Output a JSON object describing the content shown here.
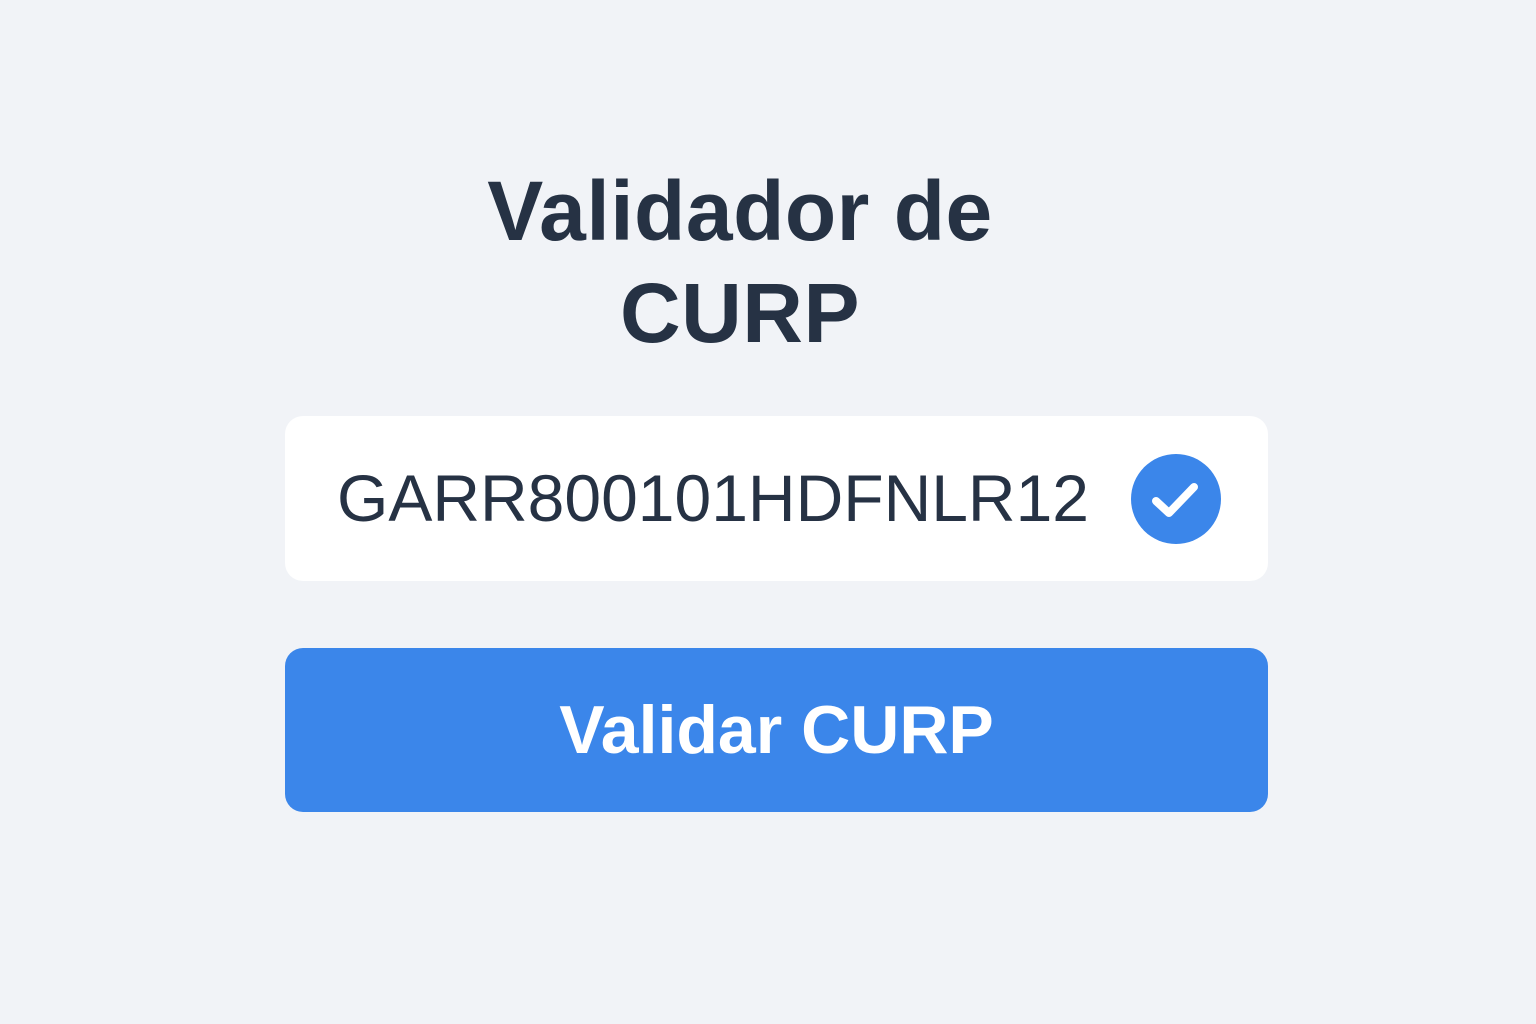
{
  "header": {
    "title_line1": "Validador de",
    "title_line2": "CURP"
  },
  "form": {
    "curp_value": "GARR800101HDFNLR12",
    "status_icon": "check-circle-icon",
    "submit_label": "Validar CURP"
  },
  "colors": {
    "background": "#f1f3f7",
    "accent": "#3b86ea",
    "text": "#263244",
    "field_background": "#ffffff"
  }
}
